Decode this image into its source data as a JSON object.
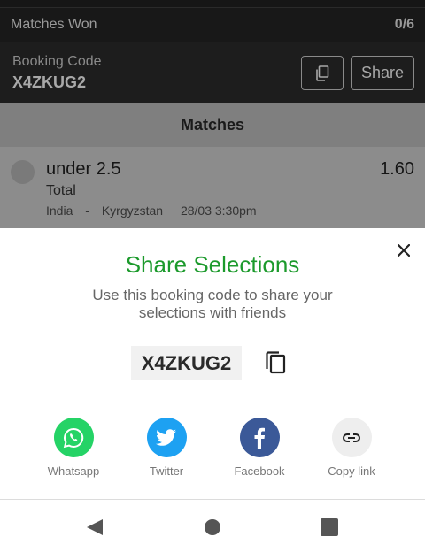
{
  "summary": {
    "matches_won_label": "Matches Won",
    "matches_won_value": "0/6"
  },
  "booking": {
    "label": "Booking Code",
    "code": "X4ZKUG2",
    "copy_icon": "copy-icon",
    "share_label": "Share"
  },
  "matches": {
    "header": "Matches",
    "items": [
      {
        "pick": "under 2.5",
        "odds": "1.60",
        "market": "Total",
        "home_team": "India",
        "separator": "-",
        "away_team": "Kyrgyzstan",
        "datetime": "28/03 3:30pm"
      }
    ]
  },
  "share_sheet": {
    "title": "Share Selections",
    "description": "Use this booking code to share your selections with friends",
    "code": "X4ZKUG2",
    "close_icon": "close-icon",
    "copy_icon": "copy-icon",
    "options": [
      {
        "label": "Whatsapp",
        "icon": "whatsapp-icon",
        "color": "#25d366"
      },
      {
        "label": "Twitter",
        "icon": "twitter-icon",
        "color": "#1da1f2"
      },
      {
        "label": "Facebook",
        "icon": "facebook-icon",
        "color": "#3b5998"
      },
      {
        "label": "Copy link",
        "icon": "link-icon",
        "color": "#eeeeee"
      }
    ]
  },
  "colors": {
    "accent_green": "#1c9a2c",
    "overlay_dark": "#1d1d1d",
    "nav_icon": "#555555"
  },
  "navbar": {
    "back_icon": "back-triangle-icon",
    "home_icon": "home-circle-icon",
    "recent_icon": "recent-apps-square-icon"
  }
}
